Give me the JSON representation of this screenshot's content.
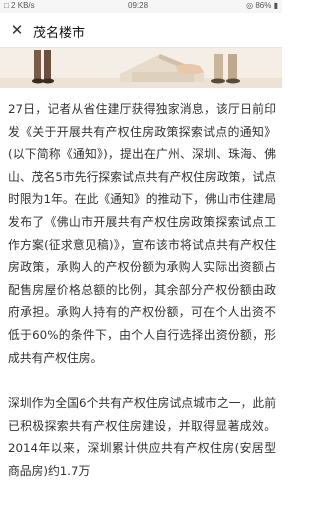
{
  "status_bar": {
    "left": "□ 2 KB/s",
    "time": "09:28",
    "right": "◎ 86% ▮"
  },
  "navbar": {
    "close_icon": "close-icon",
    "title": "茂名楼市"
  },
  "hero": {
    "image": "illustration-people-house"
  },
  "article": {
    "paragraphs": [
      "27日，记者从省住建厅获得独家消息，该厅日前印发《关于开展共有产权住房政策探索试点的通知》(以下简称《通知》)，提出在广州、深圳、珠海、佛山、茂名5市先行探索试点共有产权住房政策，试点时限为1年。在此《通知》的推动下，佛山市住建局发布了《佛山市开展共有产权住房政策探索试点工作方案(征求意见稿)》，宣布该市将试点共有产权住房政策，承购人的产权份额为承购人实际出资额占配售房屋价格总额的比例，其余部分产权份额由政府承担。承购人持有的产权份额，可在个人出资不低于60%的条件下，由个人自行选择出资份额，形成共有产权住房。",
      "深圳作为全国6个共有产权住房试点城市之一，此前已积极探索共有产权住房建设，并取得显著成效。2014年以来，深圳累计供应共有产权住房(安居型商品房)约1.7万"
    ]
  }
}
